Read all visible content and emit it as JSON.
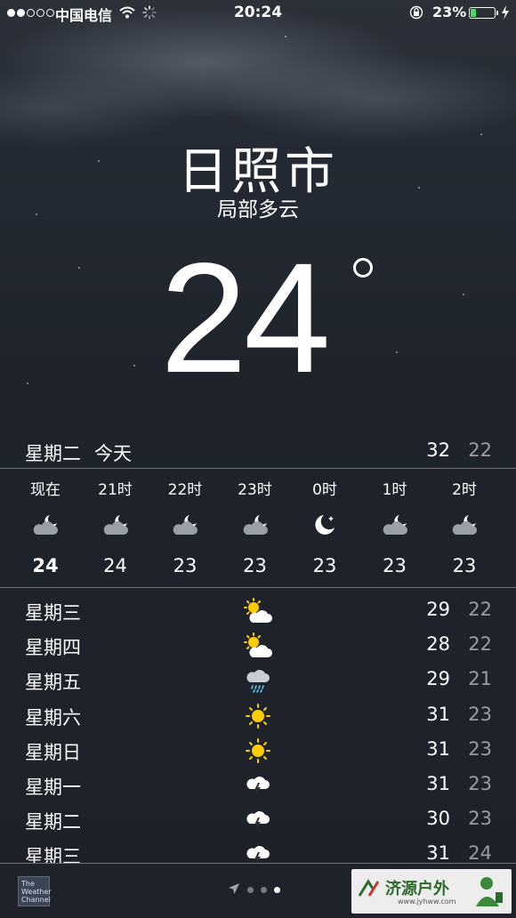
{
  "status_bar": {
    "carrier": "中国电信",
    "time": "20:24",
    "battery_percent": "23%",
    "battery_level": 0.23,
    "signal_bars_filled": 2,
    "signal_bars_total": 5,
    "battery_color": "#4cd964"
  },
  "location": {
    "city": "日照市",
    "condition": "局部多云",
    "temperature": "24"
  },
  "today": {
    "day": "星期二",
    "label": "今天",
    "high": "32",
    "low": "22"
  },
  "hourly": [
    {
      "time": "现在",
      "icon": "partly-cloudy-night-icon",
      "temp": "24"
    },
    {
      "time": "21时",
      "icon": "partly-cloudy-night-icon",
      "temp": "24"
    },
    {
      "time": "22时",
      "icon": "partly-cloudy-night-icon",
      "temp": "23"
    },
    {
      "time": "23时",
      "icon": "partly-cloudy-night-icon",
      "temp": "23"
    },
    {
      "time": "0时",
      "icon": "clear-night-icon",
      "temp": "23"
    },
    {
      "time": "1时",
      "icon": "partly-cloudy-night-icon",
      "temp": "23"
    },
    {
      "time": "2时",
      "icon": "partly-cloudy-night-icon",
      "temp": "23"
    }
  ],
  "daily": [
    {
      "day": "星期三",
      "icon": "partly-cloudy-day-icon",
      "high": "29",
      "low": "22"
    },
    {
      "day": "星期四",
      "icon": "partly-cloudy-day-icon",
      "high": "28",
      "low": "22"
    },
    {
      "day": "星期五",
      "icon": "rain-icon",
      "high": "29",
      "low": "21"
    },
    {
      "day": "星期六",
      "icon": "sunny-icon",
      "high": "31",
      "low": "23"
    },
    {
      "day": "星期日",
      "icon": "sunny-icon",
      "high": "31",
      "low": "23"
    },
    {
      "day": "星期一",
      "icon": "thunderstorm-icon",
      "high": "31",
      "low": "23"
    },
    {
      "day": "星期二",
      "icon": "thunderstorm-icon",
      "high": "30",
      "low": "23"
    },
    {
      "day": "星期三",
      "icon": "thunderstorm-icon",
      "high": "31",
      "low": "24"
    }
  ],
  "footer": {
    "provider_logo": "The Weather Channel",
    "page_count": 3,
    "active_page": 3,
    "watermark_title": "济源户外",
    "watermark_url": "www.jyhww.com"
  }
}
